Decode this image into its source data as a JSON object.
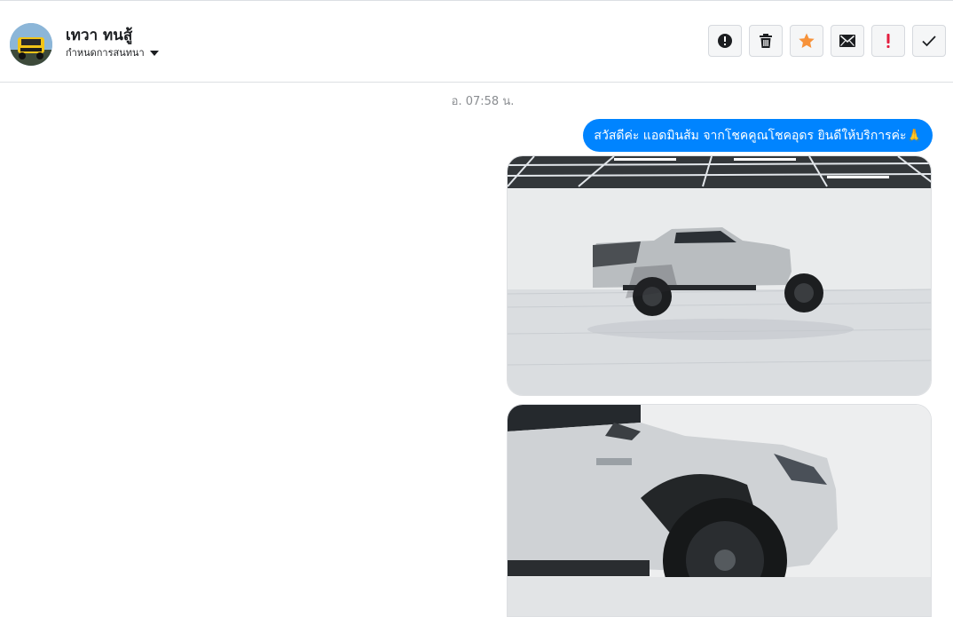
{
  "header": {
    "contact_name": "เทวา ทนสู้",
    "subtitle": "กำหนดการสนทนา",
    "avatar_icon": "avatar-image"
  },
  "actions": [
    {
      "icon": "alert-circle-icon",
      "color": "#1c1e21"
    },
    {
      "icon": "trash-icon",
      "color": "#1c1e21"
    },
    {
      "icon": "star-icon",
      "color": "#f7923a"
    },
    {
      "icon": "envelope-icon",
      "color": "#1c1e21"
    },
    {
      "icon": "exclamation-icon",
      "color": "#e41e3f"
    },
    {
      "icon": "checkmark-icon",
      "color": "#1c1e21"
    }
  ],
  "conversation": {
    "timestamp": "อ. 07:58 น.",
    "message": "สวัสดีค่ะ แอดมินส้ม จากโชคคูณโชคอุดร ยินดีให้บริการค่ะ🙏",
    "images": [
      {
        "icon": "photo-pickup-side"
      },
      {
        "icon": "photo-pickup-front-wheel"
      }
    ]
  },
  "colors": {
    "accent": "#0084ff",
    "star": "#f7923a",
    "urgent": "#e41e3f"
  }
}
